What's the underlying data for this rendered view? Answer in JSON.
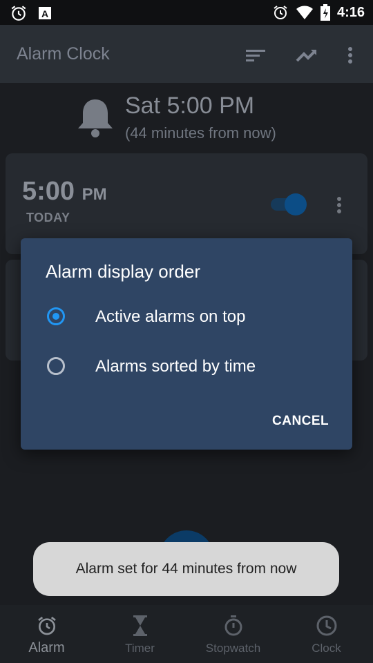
{
  "status_bar": {
    "time": "4:16",
    "left_icons": [
      "alarm-icon",
      "font-app-icon"
    ],
    "right_icons": [
      "alarm-icon",
      "wifi-icon",
      "battery-icon"
    ]
  },
  "app_bar": {
    "title": "Alarm Clock",
    "actions": [
      "sort-icon",
      "trending-icon",
      "more-vert-icon"
    ]
  },
  "next_alarm": {
    "main": "Sat 5:00 PM",
    "sub": "(44 minutes from now)"
  },
  "alarm_card": {
    "time": "5:00",
    "ampm": "PM",
    "day": "TODAY",
    "enabled": true
  },
  "dialog": {
    "title": "Alarm display order",
    "options": [
      {
        "label": "Active alarms on top",
        "selected": true
      },
      {
        "label": "Alarms sorted by time",
        "selected": false
      }
    ],
    "cancel_label": "CANCEL"
  },
  "toast": {
    "message": "Alarm set for 44 minutes from now"
  },
  "bottom_nav": {
    "items": [
      {
        "label": "Alarm",
        "icon": "alarm-icon",
        "active": true
      },
      {
        "label": "Timer",
        "icon": "hourglass-icon",
        "active": false
      },
      {
        "label": "Stopwatch",
        "icon": "stopwatch-icon",
        "active": false
      },
      {
        "label": "Clock",
        "icon": "clock-icon",
        "active": false
      }
    ]
  },
  "colors": {
    "accent": "#2196f3",
    "dialog_bg": "#2f4564",
    "toast_bg": "#d7d7d7"
  }
}
